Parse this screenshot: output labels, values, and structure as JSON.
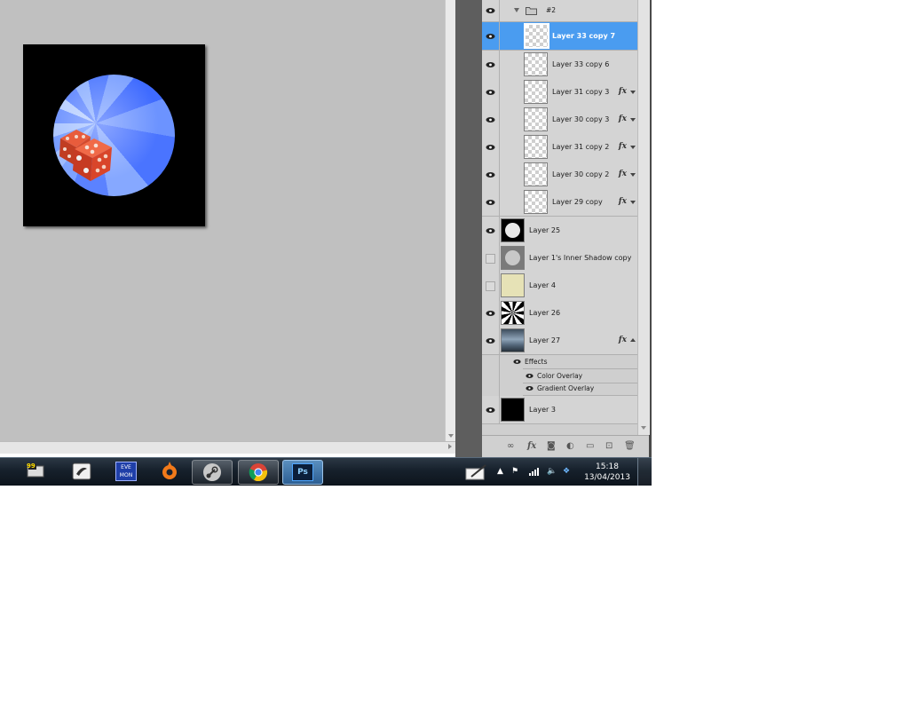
{
  "layers": [
    {
      "name": "#2",
      "type": "group"
    },
    {
      "name": "Layer 33 copy 7",
      "selected": true,
      "fx": false
    },
    {
      "name": "Layer 33 copy 6",
      "fx": false
    },
    {
      "name": "Layer 31 copy 3",
      "fx": true
    },
    {
      "name": "Layer 30 copy 3",
      "fx": true
    },
    {
      "name": "Layer 31 copy 2",
      "fx": true
    },
    {
      "name": "Layer 30 copy 2",
      "fx": true
    },
    {
      "name": "Layer 29 copy",
      "fx": true
    },
    {
      "name": "Layer 25",
      "fx": false
    },
    {
      "name": "Layer 1's Inner Shadow copy",
      "fx": false,
      "visible": false
    },
    {
      "name": "Layer 4",
      "fx": false,
      "visible": false
    },
    {
      "name": "Layer 26",
      "fx": false
    },
    {
      "name": "Layer 27",
      "fx": true,
      "expanded": true
    },
    {
      "name": "Layer 3",
      "fx": false
    }
  ],
  "effects": {
    "header": "Effects",
    "items": [
      "Color Overlay",
      "Gradient Overlay"
    ]
  },
  "fx_symbol": "fx",
  "taskbar": {
    "apps": [
      "winamp-icon",
      "xfire-icon",
      "evemon-icon",
      "origin-icon",
      "steam-icon",
      "chrome-icon",
      "photoshop-icon"
    ],
    "evemon_label": "EVE MON",
    "ps_label": "Ps",
    "notes_badge": "99"
  },
  "clock": {
    "time": "15:18",
    "date": "13/04/2013"
  },
  "colors": {
    "selection": "#4a9cf0",
    "panel": "#d4d4d4",
    "canvas_bg": "#c0c0c0"
  }
}
